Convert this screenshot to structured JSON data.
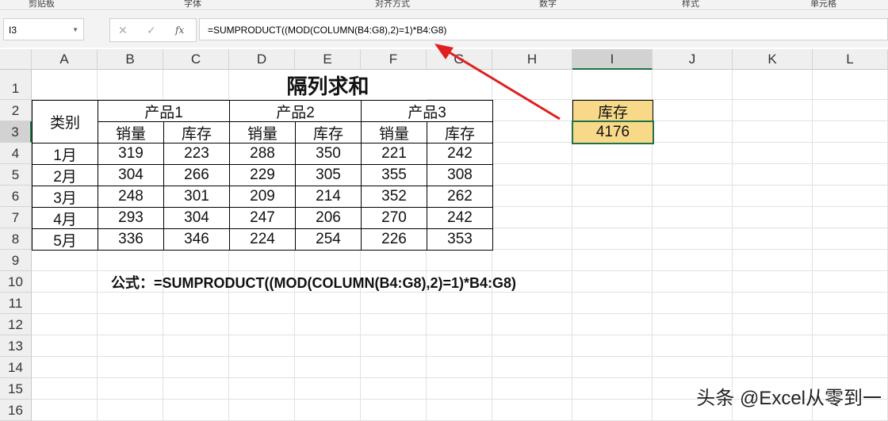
{
  "ribbon": {
    "groups": [
      "剪贴板",
      "字体",
      "对齐方式",
      "数字",
      "样式",
      "单元格"
    ]
  },
  "formula_bar": {
    "name_box": "I3",
    "cancel": "✕",
    "enter": "✓",
    "fx": "fx",
    "formula": "=SUMPRODUCT((MOD(COLUMN(B4:G8),2)=1)*B4:G8)"
  },
  "columns": [
    "A",
    "B",
    "C",
    "D",
    "E",
    "F",
    "G",
    "H",
    "I",
    "J",
    "K",
    "L"
  ],
  "rows": [
    "1",
    "2",
    "3",
    "4",
    "5",
    "6",
    "7",
    "8",
    "9",
    "10",
    "11",
    "12",
    "13",
    "14",
    "15",
    "16"
  ],
  "sheet": {
    "title": "隔列求和",
    "category_header": "类别",
    "products": [
      "产品1",
      "产品2",
      "产品3"
    ],
    "subheaders": [
      "销量",
      "库存",
      "销量",
      "库存",
      "销量",
      "库存"
    ],
    "data": [
      {
        "month": "1月",
        "values": [
          "319",
          "223",
          "288",
          "350",
          "221",
          "242"
        ]
      },
      {
        "month": "2月",
        "values": [
          "304",
          "266",
          "229",
          "305",
          "355",
          "308"
        ]
      },
      {
        "month": "3月",
        "values": [
          "248",
          "301",
          "209",
          "214",
          "352",
          "262"
        ]
      },
      {
        "month": "4月",
        "values": [
          "293",
          "304",
          "247",
          "206",
          "270",
          "242"
        ]
      },
      {
        "month": "5月",
        "values": [
          "336",
          "346",
          "224",
          "254",
          "226",
          "353"
        ]
      }
    ],
    "result_label": "库存",
    "result_value": "4176",
    "formula_note": "公式：=SUMPRODUCT((MOD(COLUMN(B4:G8),2)=1)*B4:G8)"
  },
  "watermark": "头条 @Excel从零到一",
  "colors": {
    "header_fill": "#f8d98a",
    "select_green": "#217346",
    "arrow": "#e02020"
  }
}
